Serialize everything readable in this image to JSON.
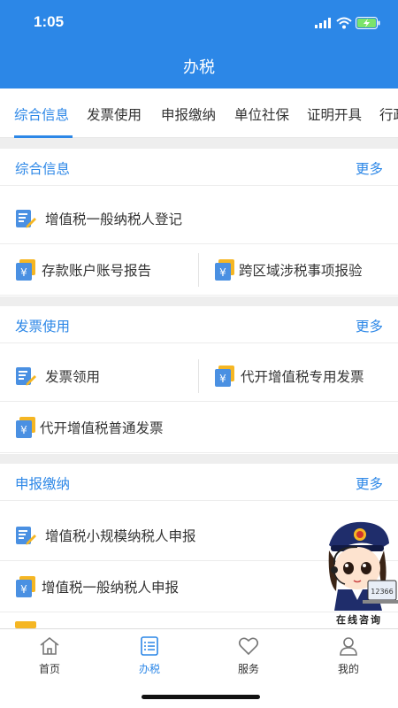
{
  "status": {
    "time": "1:05"
  },
  "header": {
    "title": "办税"
  },
  "tabs": [
    "综合信息",
    "发票使用",
    "申报缴纳",
    "单位社保",
    "证明开具",
    "行政"
  ],
  "sections": [
    {
      "title": "综合信息",
      "more": "更多",
      "rows": [
        [
          "增值税一般纳税人登记"
        ],
        [
          "存款账户账号报告",
          "跨区域涉税事项报验"
        ]
      ]
    },
    {
      "title": "发票使用",
      "more": "更多",
      "rows": [
        [
          "发票领用",
          "代开增值税专用发票"
        ],
        [
          "代开增值税普通发票"
        ]
      ]
    },
    {
      "title": "申报缴纳",
      "more": "更多",
      "rows": [
        [
          "增值税小规模纳税人申报"
        ],
        [
          "增值税一般纳税人申报"
        ]
      ]
    }
  ],
  "mascot": {
    "label": "在线咨询",
    "badge": "12366"
  },
  "icons": {
    "form": "form-edit-icon",
    "yuan": "yuan-document-icon"
  },
  "bottom_nav": [
    {
      "label": "首页",
      "icon": "home-icon"
    },
    {
      "label": "办税",
      "icon": "list-icon"
    },
    {
      "label": "服务",
      "icon": "heart-icon"
    },
    {
      "label": "我的",
      "icon": "user-icon"
    }
  ],
  "colors": {
    "accent": "#2c87e7",
    "icon_yellow": "#f5b623"
  }
}
